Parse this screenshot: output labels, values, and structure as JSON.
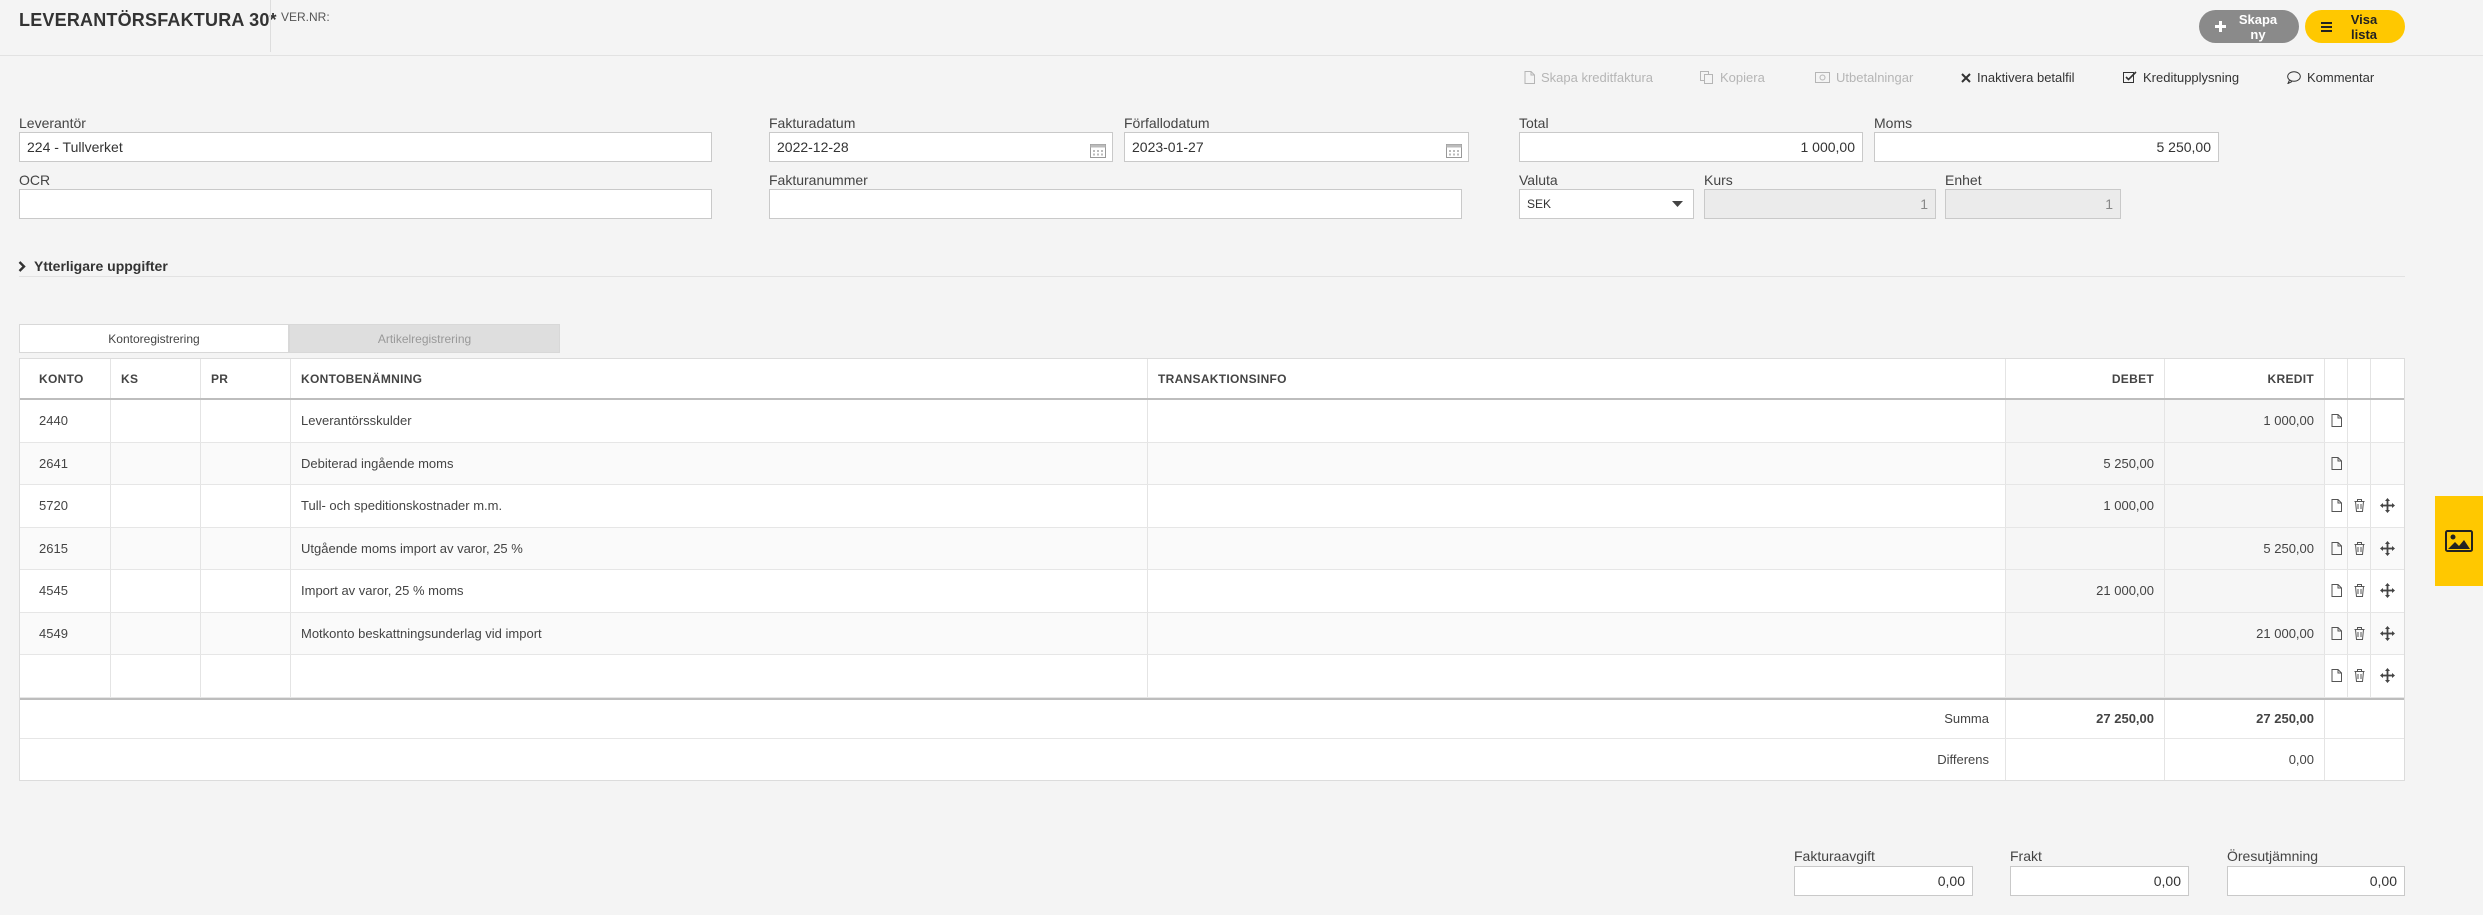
{
  "header": {
    "title": "LEVERANTÖRSFAKTURA 30*",
    "ver_label": "VER.NR:",
    "new_button": "Skapa ny",
    "list_button": "Visa lista"
  },
  "toolbar": {
    "create_credit": "Skapa kreditfaktura",
    "copy": "Kopiera",
    "payouts": "Utbetalningar",
    "deactivate_payfile": "Inaktivera betalfil",
    "credit_info": "Kreditupplysning",
    "comment": "Kommentar"
  },
  "form": {
    "supplier_label": "Leverantör",
    "supplier_value": "224 - Tullverket",
    "ocr_label": "OCR",
    "ocr_value": "",
    "invoice_date_label": "Fakturadatum",
    "invoice_date_value": "2022-12-28",
    "due_date_label": "Förfallodatum",
    "due_date_value": "2023-01-27",
    "invoice_number_label": "Fakturanummer",
    "invoice_number_value": "",
    "total_label": "Total",
    "total_value": "1 000,00",
    "vat_label": "Moms",
    "vat_value": "5 250,00",
    "currency_label": "Valuta",
    "currency_value": "SEK",
    "rate_label": "Kurs",
    "rate_value": "1",
    "unit_label": "Enhet",
    "unit_value": "1"
  },
  "more_details": "Ytterligare uppgifter",
  "tabs": {
    "account": "Kontoregistrering",
    "article": "Artikelregistrering"
  },
  "table": {
    "headers": {
      "konto": "KONTO",
      "ks": "KS",
      "pr": "PR",
      "ben": "KONTOBENÄMNING",
      "tr": "TRANSAKTIONSINFO",
      "deb": "DEBET",
      "kre": "KREDIT"
    },
    "rows": [
      {
        "konto": "2440",
        "ks": "",
        "pr": "",
        "ben": "Leverantörsskulder",
        "tr": "",
        "deb": "",
        "kre": "1 000,00"
      },
      {
        "konto": "2641",
        "ks": "",
        "pr": "",
        "ben": "Debiterad ingående moms",
        "tr": "",
        "deb": "5 250,00",
        "kre": ""
      },
      {
        "konto": "5720",
        "ks": "",
        "pr": "",
        "ben": "Tull- och speditionskostnader m.m.",
        "tr": "",
        "deb": "1 000,00",
        "kre": ""
      },
      {
        "konto": "2615",
        "ks": "",
        "pr": "",
        "ben": "Utgående moms import av varor, 25 %",
        "tr": "",
        "deb": "",
        "kre": "5 250,00"
      },
      {
        "konto": "4545",
        "ks": "",
        "pr": "",
        "ben": "Import av varor, 25 % moms",
        "tr": "",
        "deb": "21 000,00",
        "kre": ""
      },
      {
        "konto": "4549",
        "ks": "",
        "pr": "",
        "ben": "Motkonto beskattningsunderlag vid import",
        "tr": "",
        "deb": "",
        "kre": "21 000,00"
      },
      {
        "konto": "",
        "ks": "",
        "pr": "",
        "ben": "",
        "tr": "",
        "deb": "",
        "kre": ""
      }
    ],
    "sum_label": "Summa",
    "sum_debet": "27 250,00",
    "sum_kredit": "27 250,00",
    "diff_label": "Differens",
    "diff_debet": "",
    "diff_kredit": "0,00"
  },
  "footer": {
    "invoice_fee_label": "Fakturaavgift",
    "invoice_fee_value": "0,00",
    "freight_label": "Frakt",
    "freight_value": "0,00",
    "rounding_label": "Öresutjämning",
    "rounding_value": "0,00"
  }
}
